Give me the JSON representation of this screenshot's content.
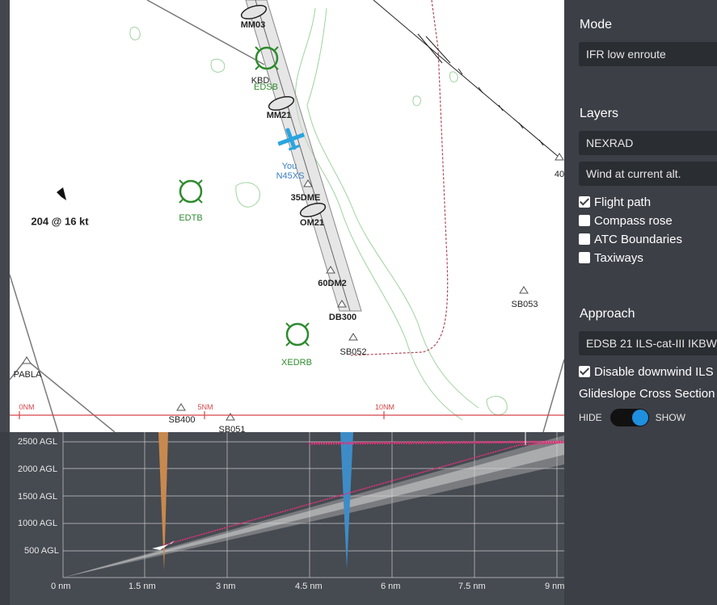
{
  "map": {
    "fixes": {
      "mm03": "MM03",
      "mm21": "MM21",
      "om21": "OM21",
      "kbd": "KBD",
      "edsb": "EDSB",
      "edtb": "EDTB",
      "xedrb": "XEDRB",
      "dme35": "35DME",
      "dm60": "60DM2",
      "db300": "DB300",
      "sb053": "SB053",
      "sb052": "SB052",
      "pabla": "PABLA",
      "sb400": "SB400",
      "sb051": "SB051",
      "edge40": "40"
    },
    "aircraft": {
      "label": "You",
      "callsign": "N45XS"
    },
    "wind": "204 @ 16 kt",
    "scale": [
      "0NM",
      "5NM",
      "10NM"
    ],
    "colors": {
      "green": "#2e8b2e",
      "route": "#b04a5a",
      "aircraft": "#2aa4e0",
      "scale": "#d6454a"
    }
  },
  "panel": {
    "mode_heading": "Mode",
    "mode_value": "IFR low enroute",
    "layers_heading": "Layers",
    "layer_1": "NEXRAD",
    "layer_2": "Wind at current alt.",
    "checks": [
      {
        "label": "Flight path",
        "checked": true
      },
      {
        "label": "Compass rose",
        "checked": false
      },
      {
        "label": "ATC Boundaries",
        "checked": false
      },
      {
        "label": "Taxiways",
        "checked": false
      }
    ],
    "approach_heading": "Approach",
    "approach_value": "EDSB 21 ILS-cat-III IKBW",
    "downwind_label": "Disable downwind ILS",
    "downwind_checked": true,
    "glideslope_heading": "Glideslope Cross Section",
    "toggle_hide": "HIDE",
    "toggle_show": "SHOW",
    "toggle_on": true
  },
  "glideslope": {
    "y_labels": [
      "2500 AGL",
      "2000 AGL",
      "1500 AGL",
      "1000 AGL",
      "500 AGL"
    ],
    "x_labels": [
      "0 nm",
      "1.5 nm",
      "3 nm",
      "4.5 nm",
      "6 nm",
      "7.5 nm",
      "9 nm"
    ],
    "marker_colors": {
      "outer": "#c8894e",
      "middle": "#3e8cc7",
      "path": "#e0337a"
    }
  }
}
